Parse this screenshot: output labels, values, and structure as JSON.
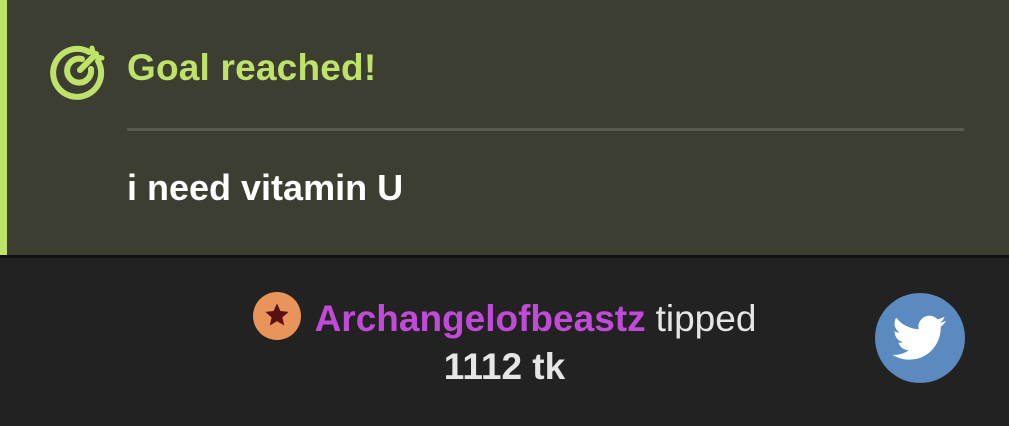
{
  "goal": {
    "title": "Goal reached!",
    "message": "i need vitamin U",
    "icon": "target-arrow-icon",
    "accent_color": "#bfe36a"
  },
  "tip": {
    "badge_icon": "star-badge-icon",
    "username": "Archangelofbeastz",
    "action": "tipped",
    "amount": "1112 tk",
    "username_color": "#c14bd8"
  },
  "share": {
    "icon": "twitter-icon",
    "color": "#5b8ac0"
  }
}
